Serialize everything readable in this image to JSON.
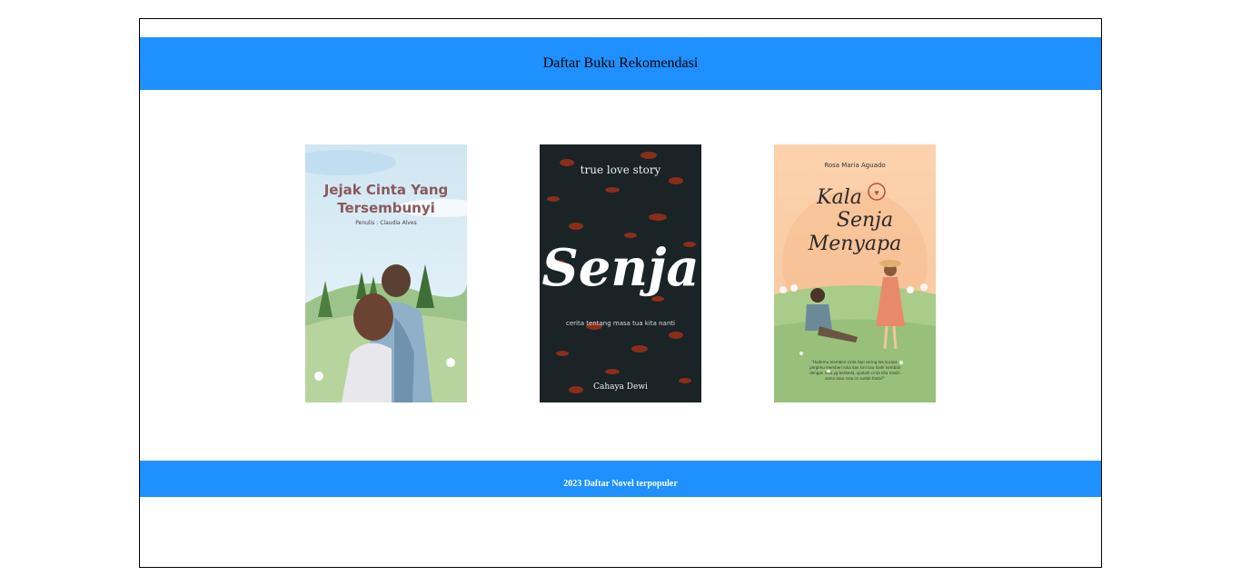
{
  "header": {
    "title": "Daftar Buku Rekomendasi"
  },
  "books": [
    {
      "title_line1": "Jejak Cinta Yang",
      "title_line2": "Tersembunyi",
      "author": "Penulis : Claudia Alves"
    },
    {
      "tagline": "true love story",
      "title": "Senja",
      "subtitle": "cerita tentang masa tua kita nanti",
      "author": "Cahaya Dewi"
    },
    {
      "author": "Rosa Maria Aguado",
      "title_line1": "Kala",
      "title_line2": "Senja",
      "title_line3": "Menyapa",
      "quote_line1": "\"Hadirmu memberi cinta tapi sering tak kurasa,",
      "quote_line2": "pergimu memberi luka dan kini kau hadir kembali",
      "quote_line3": "dengan rasa yg berbeda, apakah cinta kita masih",
      "quote_line4": "sama atau rasa ini sudah tiada?\""
    }
  ],
  "footer": {
    "text": "2023 Daftar Novel terpopuler"
  },
  "colors": {
    "accent": "#1e90ff",
    "border": "#000000"
  }
}
